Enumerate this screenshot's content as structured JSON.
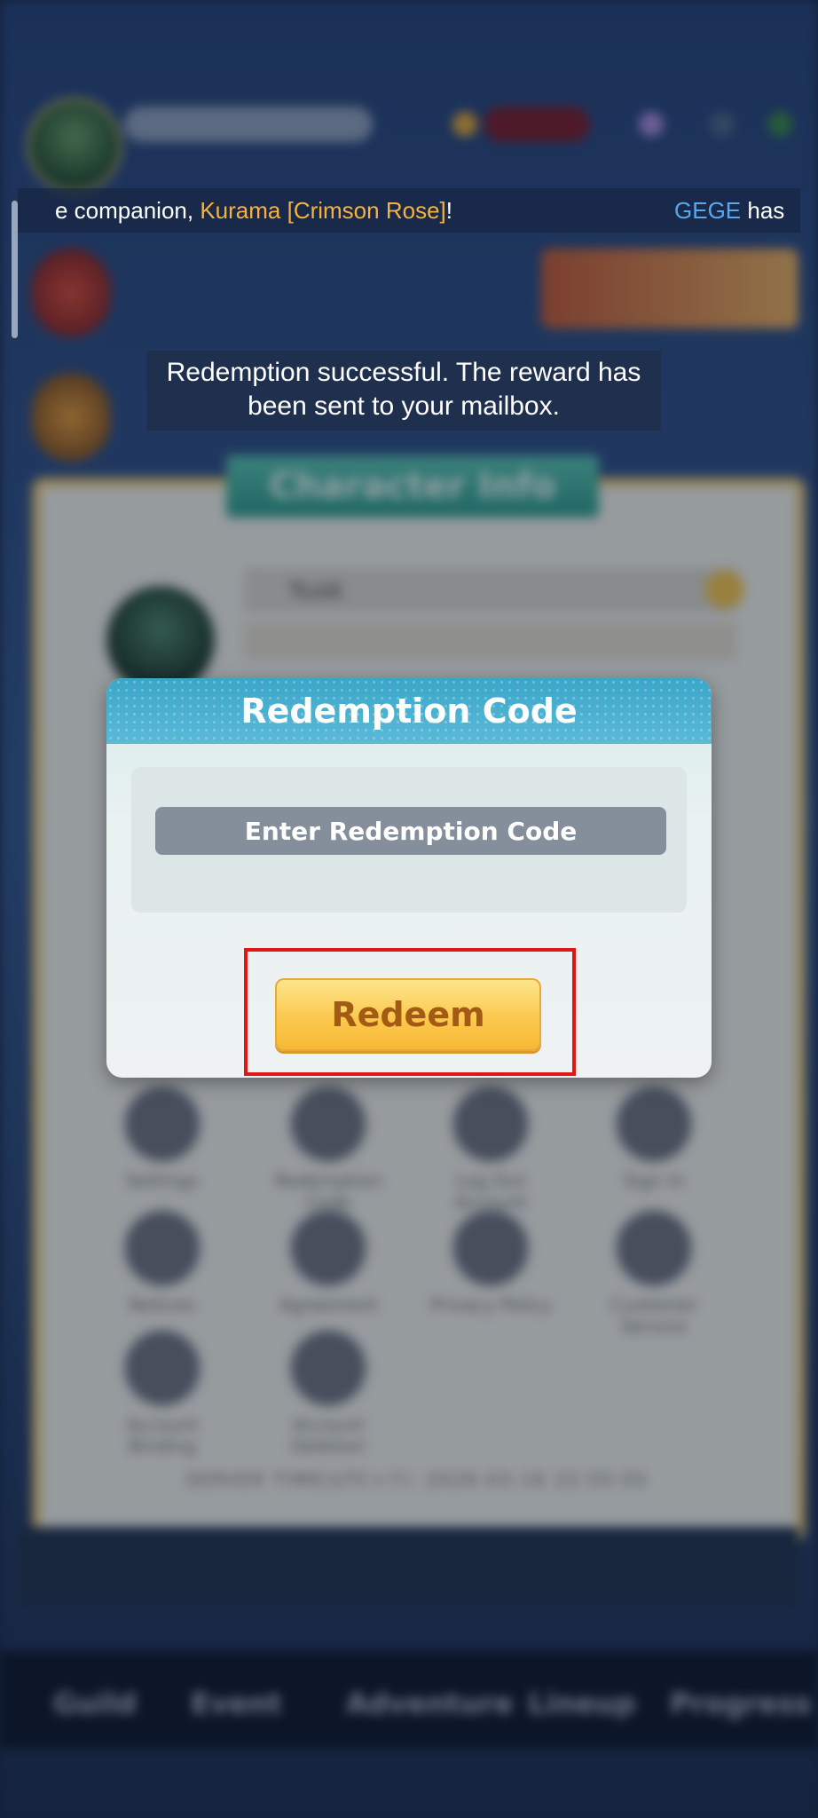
{
  "marquee": {
    "seg1_prefix": "e companion, ",
    "seg1_highlight": "Kurama [Crimson Rose]",
    "seg1_suffix": "!",
    "seg2_highlight": "GEGE",
    "seg2_suffix": " has",
    "highlight_color": "#f6b23c",
    "name_color": "#5ba7ee"
  },
  "toast": {
    "line1": "Redemption successful. The reward has",
    "line2": "been sent to your mailbox."
  },
  "dialog": {
    "title": "Redemption Code",
    "input_placeholder": "Enter Redemption Code",
    "input_value": "",
    "redeem_label": "Redeem",
    "header_color": "#3aa6c8",
    "button_color": "#fbc94e",
    "highlight_color": "#e01717"
  },
  "background": {
    "panel_title": "Character Info",
    "player_name": "Yusk",
    "grid": [
      {
        "label": "Settings",
        "icon": "gear-icon"
      },
      {
        "label": "Redemption Code",
        "icon": "gift-icon"
      },
      {
        "label": "Log Out Account",
        "icon": "logout-icon"
      },
      {
        "label": "Sign In",
        "icon": "signin-icon"
      },
      {
        "label": "Notices",
        "icon": "megaphone-icon"
      },
      {
        "label": "Agreement",
        "icon": "document-icon"
      },
      {
        "label": "Privacy Policy",
        "icon": "privacy-icon"
      },
      {
        "label": "Customer Service",
        "icon": "headset-icon"
      },
      {
        "label": "Account Binding",
        "icon": "account-link-icon"
      },
      {
        "label": "Account Deletion",
        "icon": "account-delete-icon"
      }
    ],
    "server_time": "SERVER TIME(UTC+7): 2026-03-16 22:55:55",
    "nav": [
      "Guild",
      "Event",
      "Adventure",
      "Lineup",
      "Progress"
    ]
  }
}
